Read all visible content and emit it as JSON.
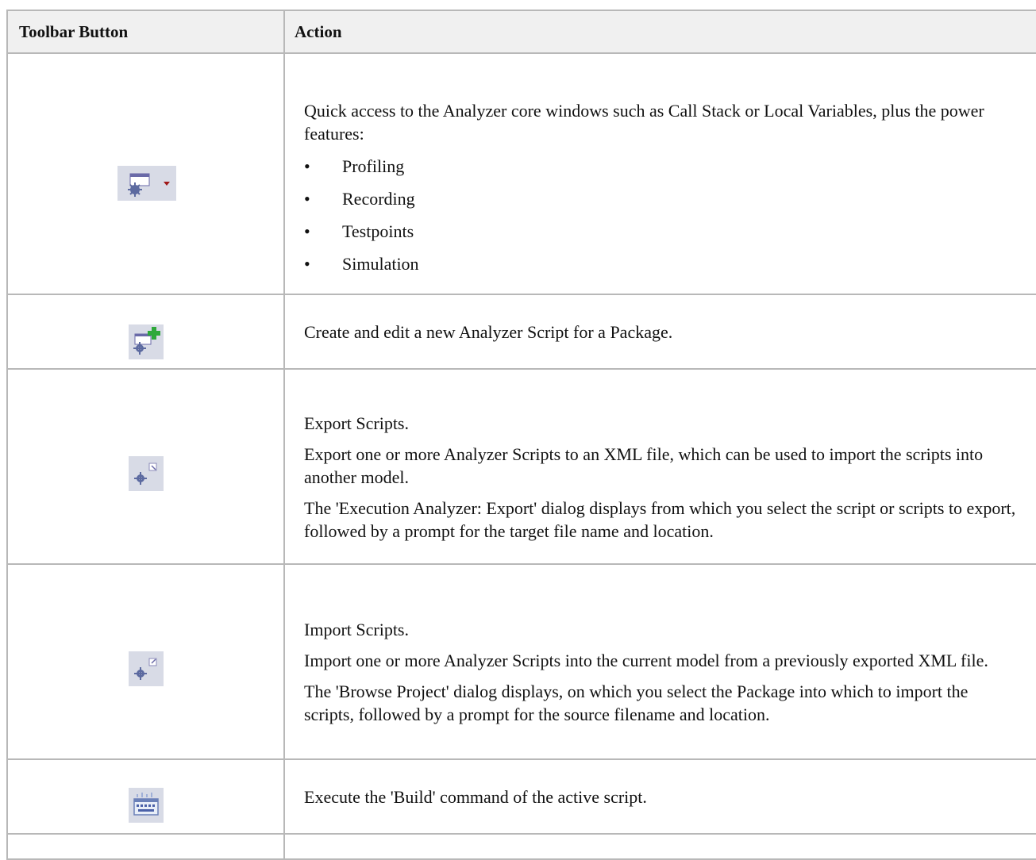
{
  "table": {
    "headers": {
      "button": "Toolbar Button",
      "action": "Action"
    },
    "rows": [
      {
        "icon": "analyzer-windows-dropdown-icon",
        "intro": "Quick access to the Analyzer core windows such as Call Stack or Local Variables, plus the power features:",
        "features": [
          "Profiling",
          "Recording",
          "Testpoints",
          "Simulation"
        ],
        "bullet": "•"
      },
      {
        "icon": "new-analyzer-script-icon",
        "text": "Create and edit a new Analyzer Script for a Package."
      },
      {
        "icon": "export-scripts-icon",
        "title": "Export Scripts.",
        "p1": "Export one or more Analyzer Scripts to an XML file, which can be used to import the scripts into another model.",
        "p2": "The 'Execution Analyzer: Export' dialog displays from which you select the script or scripts to export, followed by a prompt for the target file name and location."
      },
      {
        "icon": "import-scripts-icon",
        "title": "Import Scripts.",
        "p1": "Import one or more Analyzer Scripts into the current model from a previously exported XML file.",
        "p2": "The 'Browse Project' dialog displays, on which you select the Package into which to import the scripts, followed by a prompt for the source filename and location."
      },
      {
        "icon": "build-command-icon",
        "text": "Execute the 'Build' command of the active script."
      }
    ]
  },
  "colors": {
    "header_bg": "#f0f0f0",
    "border": "#b8b8b8",
    "icon_bg": "#d8dbe6",
    "gear": "#6a6aa8",
    "accent_green": "#2ea83a",
    "accent_red": "#a01818"
  }
}
